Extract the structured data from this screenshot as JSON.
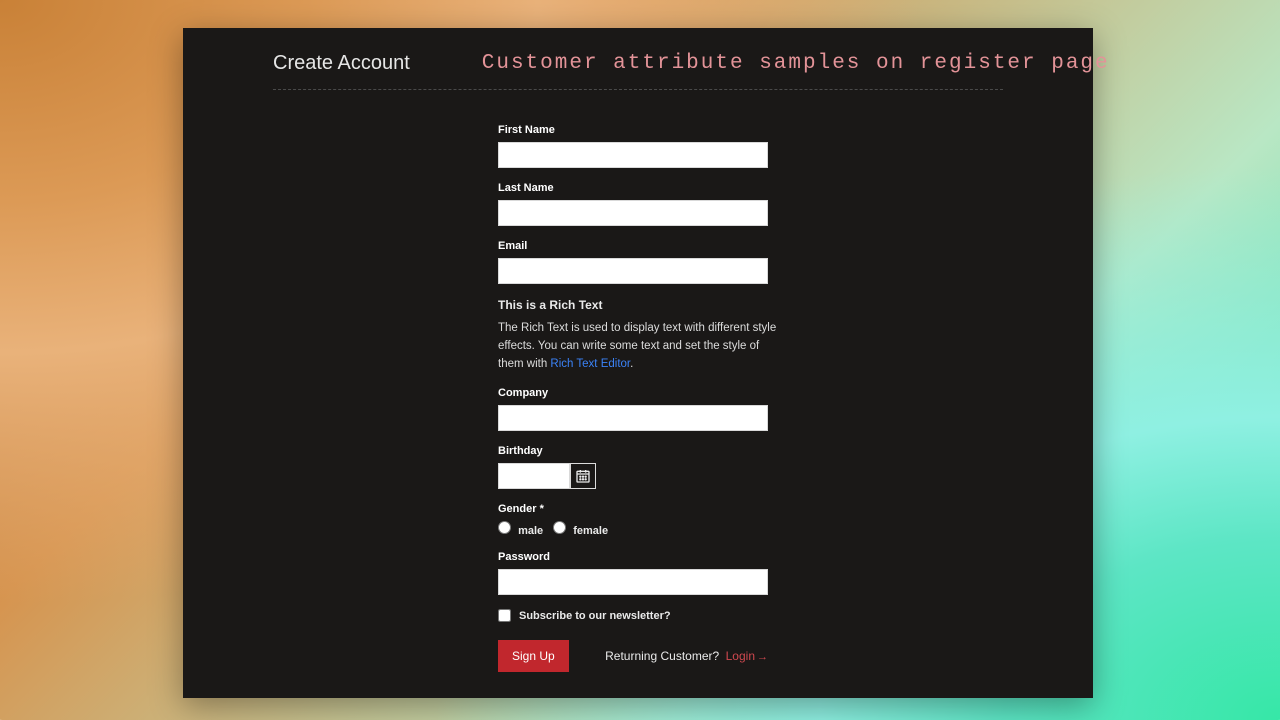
{
  "header": {
    "title": "Create Account",
    "subtitle": "Customer attribute samples on register page"
  },
  "form": {
    "first_name": {
      "label": "First Name",
      "value": ""
    },
    "last_name": {
      "label": "Last Name",
      "value": ""
    },
    "email": {
      "label": "Email",
      "value": ""
    },
    "rich": {
      "heading": "This is a Rich Text",
      "text_prefix": "The Rich Text is used to display text with different style effects. You can write some text and set the style of them with ",
      "link_text": "Rich Text Editor",
      "text_suffix": "."
    },
    "company": {
      "label": "Company",
      "value": ""
    },
    "birthday": {
      "label": "Birthday",
      "value": ""
    },
    "gender": {
      "label": "Gender *",
      "options": {
        "male": "male",
        "female": "female"
      }
    },
    "password": {
      "label": "Password",
      "value": ""
    },
    "newsletter": {
      "label": "Subscribe to our newsletter?",
      "checked": false
    },
    "submit_label": "Sign Up",
    "returning_text": "Returning Customer?",
    "login_label": "Login"
  },
  "icons": {
    "calendar": "calendar-icon",
    "arrow": "→"
  }
}
